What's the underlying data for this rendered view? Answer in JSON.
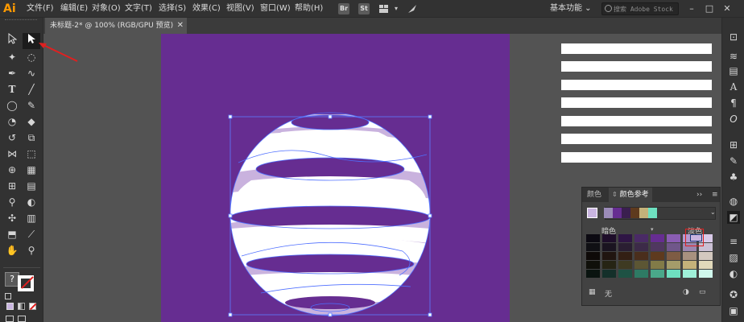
{
  "app": {
    "logo": "Ai"
  },
  "menu": [
    "文件(F)",
    "编辑(E)",
    "对象(O)",
    "文字(T)",
    "选择(S)",
    "效果(C)",
    "视图(V)",
    "窗口(W)",
    "帮助(H)"
  ],
  "menubar_icons": {
    "bridge": "Br",
    "stock": "St",
    "arrange": "arrange-icon",
    "gpu": "gpu-icon"
  },
  "workspace": {
    "label": "基本功能 ⌄"
  },
  "search": {
    "placeholder": "搜索 Adobe Stock"
  },
  "window_controls": [
    "–",
    "□",
    "✕"
  ],
  "document_tab": {
    "title": "未标题-2* @ 100% (RGB/GPU 预览)",
    "close": "✕"
  },
  "toolbar": {
    "tools": [
      "selection-tool",
      "direct-selection-tool",
      "magic-wand-tool",
      "lasso-tool",
      "pen-tool",
      "curvature-tool",
      "type-tool",
      "line-segment-tool",
      "ellipse-tool",
      "paintbrush-tool",
      "shaper-tool",
      "eraser-tool",
      "rotate-tool",
      "scale-tool",
      "width-tool",
      "free-transform-tool",
      "shape-builder-tool",
      "perspective-grid-tool",
      "mesh-tool",
      "gradient-tool",
      "eyedropper-tool",
      "blend-tool",
      "symbol-sprayer-tool",
      "column-graph-tool",
      "artboard-tool",
      "slice-tool",
      "hand-tool",
      "zoom-tool"
    ],
    "fill_question": "?"
  },
  "artboard": {
    "background": "#662d91",
    "sphere_fill": "#ffffff",
    "sphere_tint": "#c7b1dd",
    "path_color": "#4f6fff"
  },
  "color_guide": {
    "tabs": [
      "颜色",
      "颜色参考"
    ],
    "menu_button": "≡",
    "collapse": "››",
    "harmony_colors": [
      "#9b8bb8",
      "#662d91",
      "#3a1f4f",
      "#5e3a1e",
      "#c4b27a",
      "#6ee0c0"
    ],
    "base_color": "#c9b5e0",
    "label_darker": "暗色",
    "label_lighter": "淡色",
    "variations": [
      [
        "#0c0a12",
        "#1e0e2a",
        "#2f1545",
        "#4a2a66",
        "#662d91",
        "#8a5db3",
        "#b49ad1",
        "#d8c9e8"
      ],
      [
        "#101014",
        "#1a1420",
        "#2a1e32",
        "#3c2a48",
        "#503760",
        "#70578a",
        "#9c87b0",
        "#cac0d4"
      ],
      [
        "#0e0a08",
        "#201510",
        "#331f14",
        "#4a2e1c",
        "#5e3a1e",
        "#7e5c44",
        "#a8917f",
        "#d3c8bf"
      ],
      [
        "#10100a",
        "#262414",
        "#3e3a22",
        "#5c5634",
        "#827b48",
        "#a49c6a",
        "#c4b27a",
        "#e1d9bb"
      ],
      [
        "#0a1410",
        "#14302a",
        "#1e5244",
        "#2e7a64",
        "#4aa88a",
        "#6ee0c0",
        "#9ff0d8",
        "#d0f8ec"
      ]
    ],
    "footer_none": "无",
    "footer_icons": [
      "swatch-library-icon",
      "color-wheel-icon",
      "save-group-icon"
    ]
  }
}
